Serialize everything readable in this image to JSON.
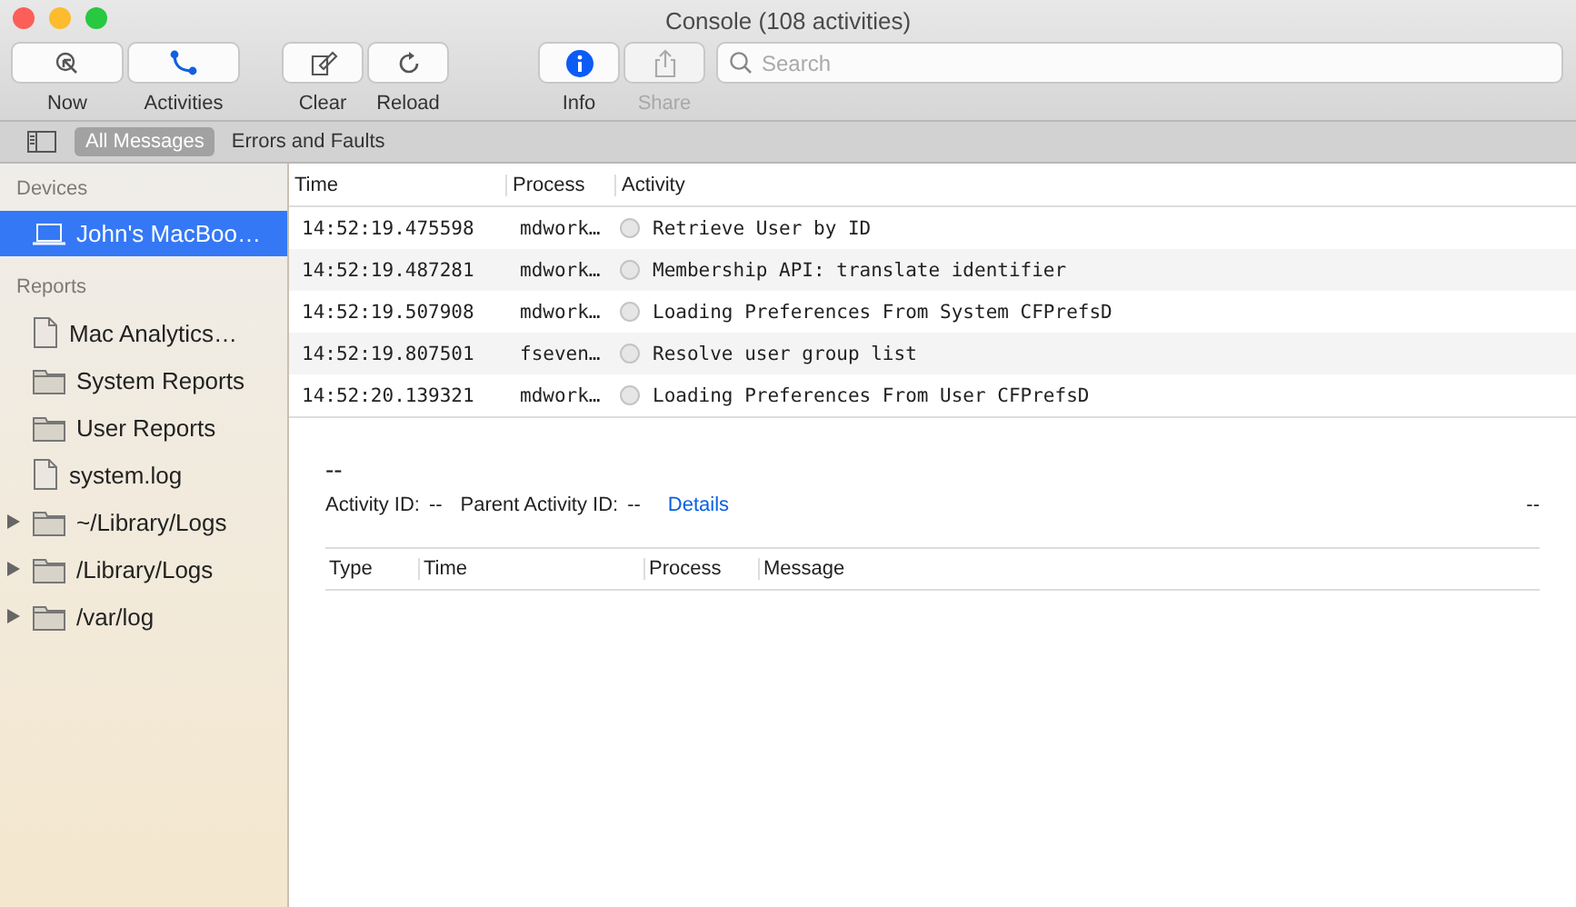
{
  "window": {
    "title": "Console (108 activities)"
  },
  "toolbar": [
    {
      "label": "Now",
      "kind": "now",
      "disabled": false
    },
    {
      "label": "Activities",
      "kind": "activities",
      "disabled": false
    },
    {
      "label": "Clear",
      "kind": "clear",
      "disabled": false
    },
    {
      "label": "Reload",
      "kind": "reload",
      "disabled": false
    },
    {
      "label": "Info",
      "kind": "info",
      "disabled": false
    },
    {
      "label": "Share",
      "kind": "share",
      "disabled": true
    }
  ],
  "search": {
    "placeholder": "Search"
  },
  "filters": [
    {
      "label": "All Messages",
      "selected": true
    },
    {
      "label": "Errors and Faults",
      "selected": false
    }
  ],
  "sidebar": {
    "sections": [
      {
        "title": "Devices",
        "items": [
          {
            "label": "John's MacBoo…",
            "kind": "device",
            "selected": true,
            "expandable": false
          }
        ]
      },
      {
        "title": "Reports",
        "items": [
          {
            "label": "Mac Analytics…",
            "kind": "file",
            "selected": false,
            "expandable": false
          },
          {
            "label": "System Reports",
            "kind": "folder",
            "selected": false,
            "expandable": false
          },
          {
            "label": "User Reports",
            "kind": "folder",
            "selected": false,
            "expandable": false
          },
          {
            "label": "system.log",
            "kind": "file",
            "selected": false,
            "expandable": false
          },
          {
            "label": "~/Library/Logs",
            "kind": "folder",
            "selected": false,
            "expandable": true
          },
          {
            "label": "/Library/Logs",
            "kind": "folder",
            "selected": false,
            "expandable": true
          },
          {
            "label": "/var/log",
            "kind": "folder",
            "selected": false,
            "expandable": true
          }
        ]
      }
    ]
  },
  "table": {
    "columns": [
      "Time",
      "Process",
      "Activity"
    ],
    "rows": [
      {
        "time": "14:52:19.475598",
        "process": "mdwork…",
        "activity": "Retrieve User by ID"
      },
      {
        "time": "14:52:19.487281",
        "process": "mdwork…",
        "activity": "Membership API: translate identifier"
      },
      {
        "time": "14:52:19.507908",
        "process": "mdwork…",
        "activity": "Loading Preferences From System CFPrefsD"
      },
      {
        "time": "14:52:19.807501",
        "process": "fseven…",
        "activity": "Resolve user group list"
      },
      {
        "time": "14:52:20.139321",
        "process": "mdwork…",
        "activity": "Loading Preferences From User CFPrefsD"
      }
    ]
  },
  "detail": {
    "title": "--",
    "activity_id_label": "Activity ID:",
    "activity_id": "--",
    "parent_label": "Parent Activity ID:",
    "parent_id": "--",
    "link": "Details",
    "right_value": "--",
    "columns": [
      "Type",
      "Time",
      "Process",
      "Message"
    ]
  }
}
